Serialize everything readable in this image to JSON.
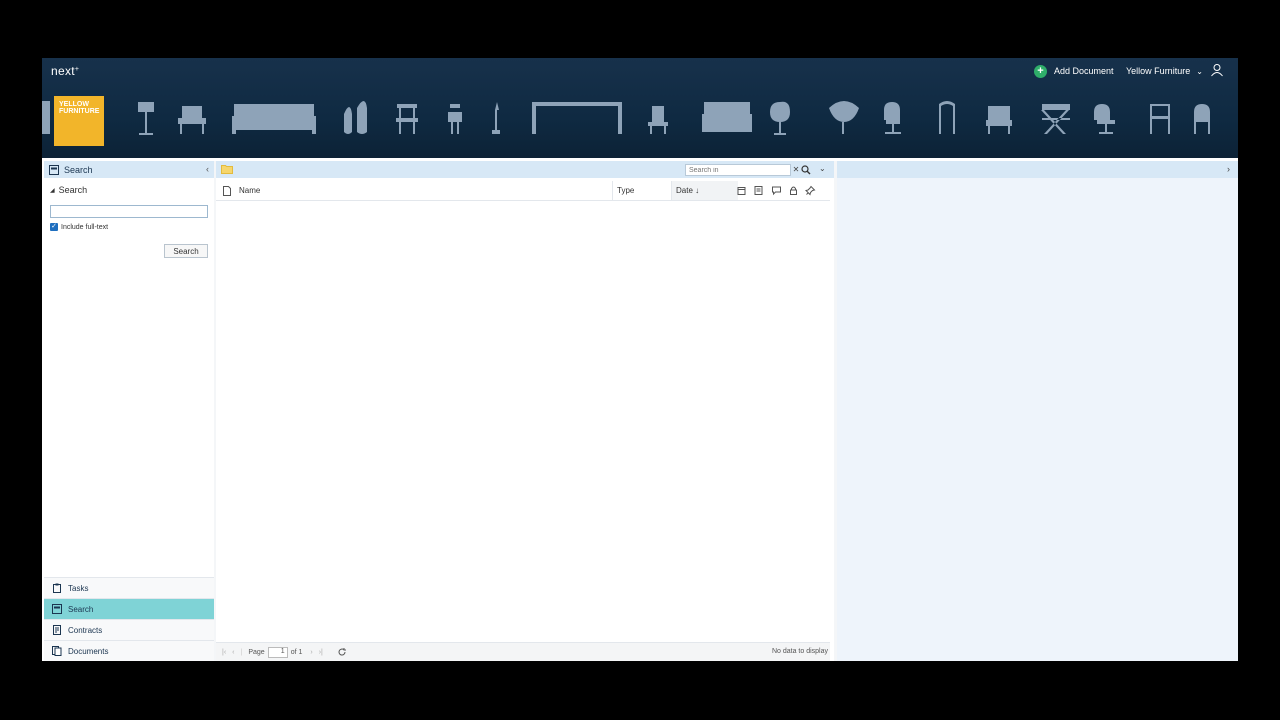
{
  "header": {
    "logo_text": "next",
    "add_document_label": "Add Document",
    "company_name": "Yellow Furniture",
    "brand_tile_line1": "YELLOW",
    "brand_tile_line2": "FURNITURE"
  },
  "left_panel": {
    "title": "Search",
    "section_title": "Search",
    "search_value": "",
    "include_fulltext_label": "Include full-text",
    "include_fulltext_checked": true,
    "search_button_label": "Search",
    "nav_items": [
      {
        "label": "Tasks",
        "icon": "clipboard-icon",
        "active": false
      },
      {
        "label": "Search",
        "icon": "search-panel-icon",
        "active": true
      },
      {
        "label": "Contracts",
        "icon": "contract-icon",
        "active": false
      },
      {
        "label": "Documents",
        "icon": "documents-icon",
        "active": false
      }
    ]
  },
  "center": {
    "search_in_placeholder": "Search in",
    "columns": {
      "name": "Name",
      "type": "Type",
      "date": "Date ↓"
    },
    "pager": {
      "page_label": "Page",
      "page_value": "1",
      "of_label": "of 1",
      "no_data": "No data to display"
    }
  },
  "colors": {
    "header_bg": "#0f2a42",
    "panel_head": "#d7e8f6",
    "active_nav": "#7fd3d6",
    "brand_yellow": "#f2b52a",
    "add_green": "#2fae6a"
  }
}
